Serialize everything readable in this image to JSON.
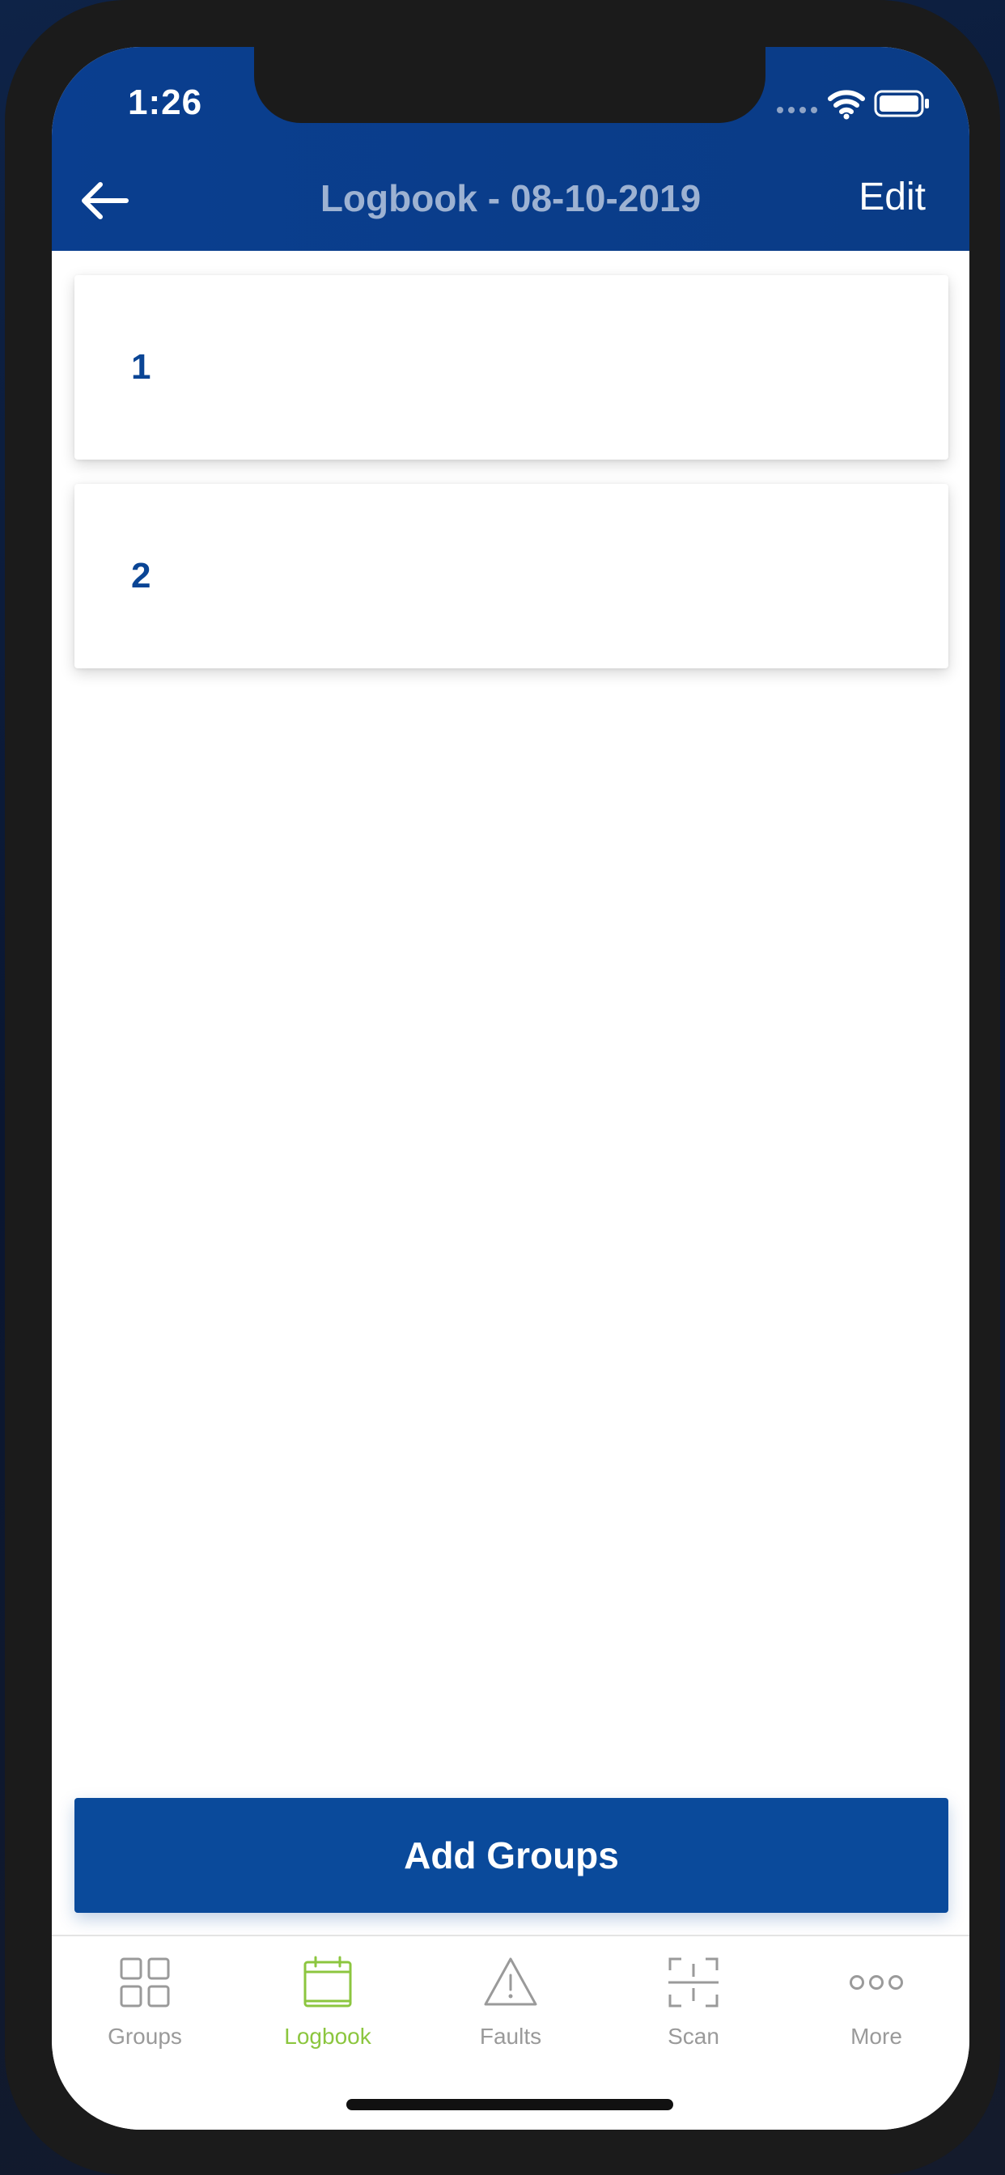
{
  "status_bar": {
    "time": "1:26"
  },
  "header": {
    "title": "Logbook - 08-10-2019",
    "edit_label": "Edit",
    "back_icon": "arrow-left-icon"
  },
  "groups": [
    {
      "label": "1"
    },
    {
      "label": "2"
    }
  ],
  "add_button_label": "Add Groups",
  "tabbar": {
    "active_tab": "Logbook",
    "tabs": [
      {
        "label": "Groups",
        "icon": "grid-icon"
      },
      {
        "label": "Logbook",
        "icon": "calendar-icon"
      },
      {
        "label": "Faults",
        "icon": "warning-icon"
      },
      {
        "label": "Scan",
        "icon": "scan-icon"
      },
      {
        "label": "More",
        "icon": "more-dots-icon"
      }
    ]
  },
  "colors": {
    "header_blue": "#0a3e8f",
    "button_blue": "#0a4a9b",
    "card_text_blue": "#0a4595",
    "active_tab_green": "#8cc63f",
    "inactive_tab_gray": "#9a9a9a"
  }
}
